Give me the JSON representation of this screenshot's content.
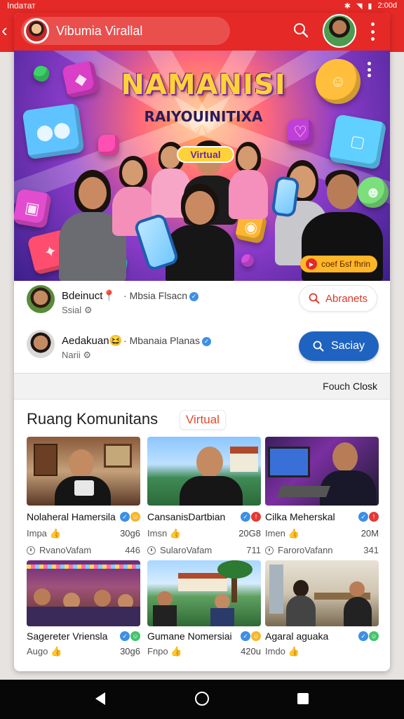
{
  "status_bar": {
    "carrier": "Indaтат",
    "time": "2:00d"
  },
  "app": {
    "title": "Vibumia Virallal",
    "search_icon": "search-icon",
    "menu_icon": "more-vertical-icon"
  },
  "banner": {
    "title": "NAMANISI",
    "subtitle": "RAIYOUINITIXA",
    "tag": "Virtual",
    "cta": "соеf Бsf fhrin"
  },
  "users": [
    {
      "name": "Bdeinuct",
      "emoji": "📍",
      "subtitle": "Ssial",
      "meta": "Mbsia Flsacn",
      "button_label": "Abranets",
      "button_icon": "search-icon"
    },
    {
      "name": "Aedakuan",
      "emoji": "😆",
      "subtitle": "Narii",
      "meta": "Mbanaia Planas",
      "button_label": "Saciay",
      "button_icon": "search-icon"
    }
  ],
  "close_bar": {
    "prefix": "Fouch",
    "label": "Closk"
  },
  "community": {
    "title": "Ruang Komunitans",
    "tag": "Virtual",
    "tiles": [
      {
        "name": "Nolaheral Hamersila",
        "sub": "Impa",
        "count": "30g6",
        "meta": "RvanoVafam",
        "meta_value": "446"
      },
      {
        "name": "CansanisDartbian",
        "sub": "Imsn",
        "count": "20G8",
        "meta": "SularoVafam",
        "meta_value": "711"
      },
      {
        "name": "Cilka Meherskal",
        "sub": "Imen",
        "count": "20M",
        "meta": "FaroroVafann",
        "meta_value": "341"
      },
      {
        "name": "Sagereter Vriensla",
        "sub": "Augo",
        "count": "30g6",
        "meta": "",
        "meta_value": ""
      },
      {
        "name": "Gumane Nomersiai",
        "sub": "Fnpo",
        "count": "420u",
        "meta": "",
        "meta_value": ""
      },
      {
        "name": "Agaral aguaka",
        "sub": "Imdo",
        "count": "",
        "meta": "",
        "meta_value": ""
      }
    ]
  },
  "colors": {
    "brand_red": "#e42926",
    "primary_blue": "#1f63c0",
    "accent_orange": "#e04a2a"
  }
}
